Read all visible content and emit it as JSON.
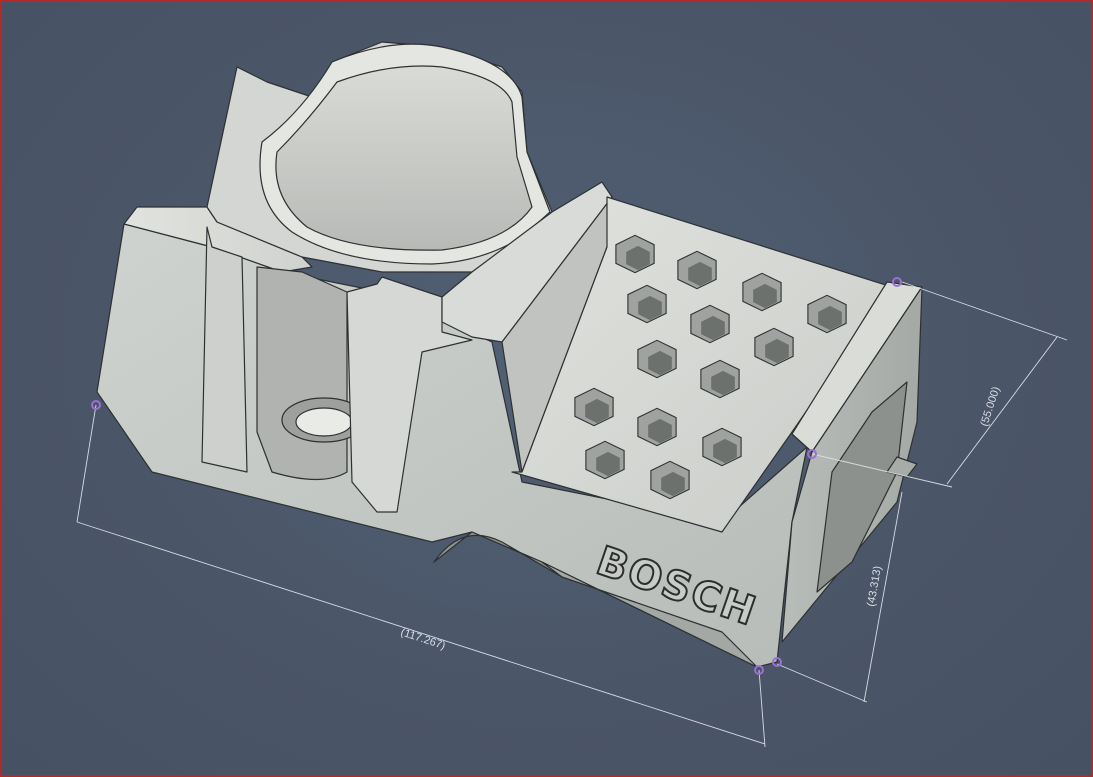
{
  "model": {
    "brand_text": "BOSCH",
    "body_color": "#c6cac6",
    "face_light": "#dcdfdb",
    "face_mid": "#b9bcb9",
    "face_dark": "#9ea19e",
    "edge_color": "#2e3133"
  },
  "dimensions": [
    {
      "label": "(117.267)"
    },
    {
      "label": "(55.000)"
    },
    {
      "label": "(43.313)"
    }
  ],
  "ui": {
    "background": "#4a5567",
    "dimension_line_color": "#d7dbe3",
    "selection_point_color": "#9b6fd6",
    "frame_color": "#b22a2a"
  }
}
